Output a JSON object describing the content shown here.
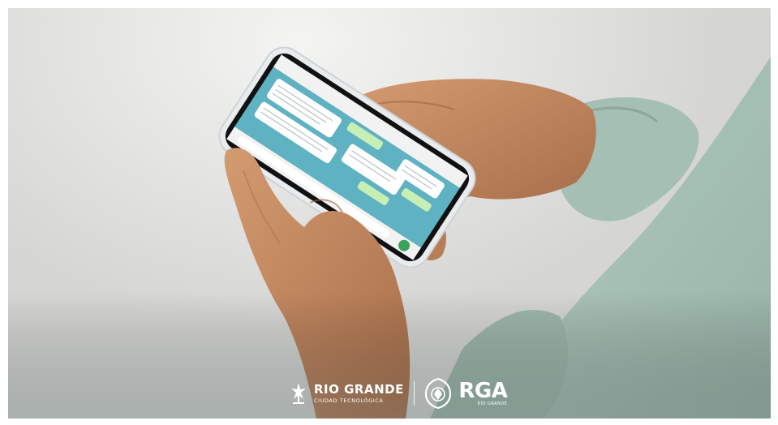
{
  "logos": {
    "left": {
      "name": "RIO GRANDE",
      "subtitle": "CIUDAD TECNOLÓGICA",
      "icon": "rio-grande-emblem-icon"
    },
    "right": {
      "name": "RGA",
      "subtitle": "RÍO GRANDE",
      "icon": "rga-crest-icon"
    }
  },
  "colors": {
    "background": "#d9dad8",
    "chat_wallpaper": "#5fb2c2",
    "send_button": "#3aa35a",
    "sleeve": "#a9c2b8",
    "skin": "#c58a62"
  }
}
